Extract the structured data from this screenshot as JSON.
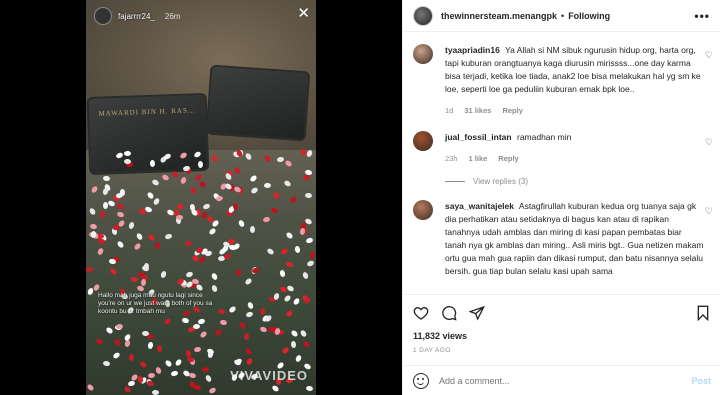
{
  "story": {
    "username": "fajarrrr24_",
    "time": "26m",
    "close_glyph": "✕",
    "caption": "Hallo mah juga mau ngutu lagi since you're on ur we just want both of you sa koontu bu ur tmbah mu",
    "watermark": "VIVAVIDEO",
    "stone_a_text": "MAWARDI BIN H. RAS...",
    "stone_b_text": ""
  },
  "post": {
    "username": "thewinnersteam.menangpk",
    "dot": "•",
    "follow_label": "Following",
    "more_glyph": "•••"
  },
  "comments": [
    {
      "username": "tyaapriadin16",
      "text": "Ya Allah si NM sibuk ngurusin hidup org, harta org, tapi kuburan orangtuanya kaga diurusin mirissss...one day karma bisa terjadi, ketika loe tiada, anak2 loe bisa melakukan hal yg sm ke loe, seperti loe ga peduliin kuburan emak bpk loe..",
      "age": "1d",
      "likes": "31 likes",
      "reply_label": "Reply",
      "avatar_color": "#c9a28a"
    },
    {
      "username": "jual_fossil_intan",
      "text": "ramadhan min",
      "age": "23h",
      "likes": "1 like",
      "reply_label": "Reply",
      "avatar_color": "#a0522d",
      "view_replies": "View replies (3)"
    },
    {
      "username": "saya_wanitajelek",
      "text": "Astagfirullah kuburan kedua org tuanya saja gk dia perhatikan atau setidaknya di bagus kan atau di rapikan tanahnya udah amblas dan miring di kasi papan pembatas biar tanah nya gk amblas dan miring.. Asli miris bgt.. Gua netizen makam ortu gua mah gua rapiin dan dikasi rumput, dan batu nisannya selalu bersih. gua tiap bulan selalu kasi upah sama",
      "avatar_color": "#b7795b"
    }
  ],
  "stats": {
    "views": "11,832 views",
    "date": "1 DAY AGO"
  },
  "composer": {
    "placeholder": "Add a comment...",
    "post_label": "Post"
  },
  "icons": {
    "like": "heart-icon",
    "comment": "comment-icon",
    "share": "share-icon",
    "save": "bookmark-icon",
    "emoji": "emoji-icon"
  }
}
